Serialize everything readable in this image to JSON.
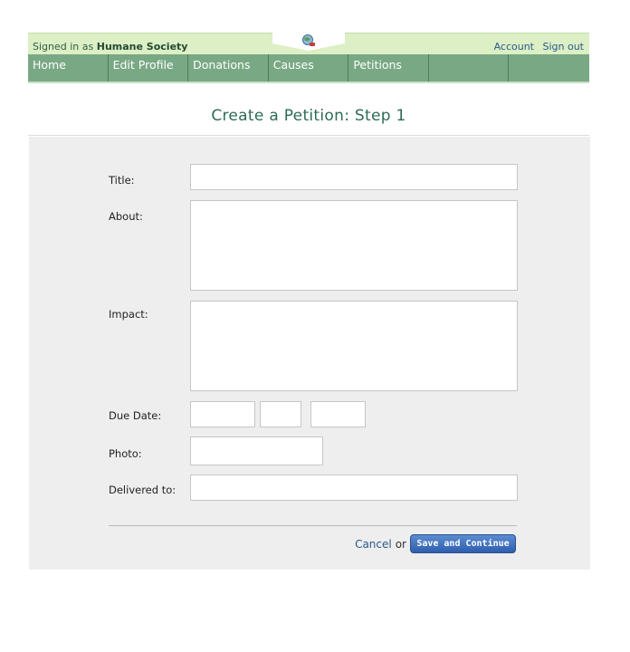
{
  "header": {
    "signed_in_prefix": "Signed in as",
    "organization": "Humane Society",
    "account_link": "Account",
    "signout_link": "Sign out",
    "logo_icon": "globe-icon"
  },
  "nav": {
    "items": [
      "Home",
      "Edit Profile",
      "Donations",
      "Causes",
      "Petitions",
      "",
      ""
    ]
  },
  "page": {
    "title": "Create a Petition: Step 1"
  },
  "form": {
    "title_label": "Title:",
    "about_label": "About:",
    "impact_label": "Impact:",
    "due_date_label": "Due Date:",
    "photo_label": "Photo:",
    "delivered_label": "Delivered to:",
    "title_value": "",
    "about_value": "",
    "impact_value": "",
    "due_month": "",
    "due_day": "",
    "due_year": "",
    "delivered_value": ""
  },
  "actions": {
    "cancel": "Cancel",
    "or": "or",
    "save": "Save and Continue"
  },
  "colors": {
    "topbar": "#dcefc5",
    "navbar": "#79a984",
    "title": "#2e6b55",
    "link": "#2a5a8a",
    "button": "#3a6bbd"
  }
}
